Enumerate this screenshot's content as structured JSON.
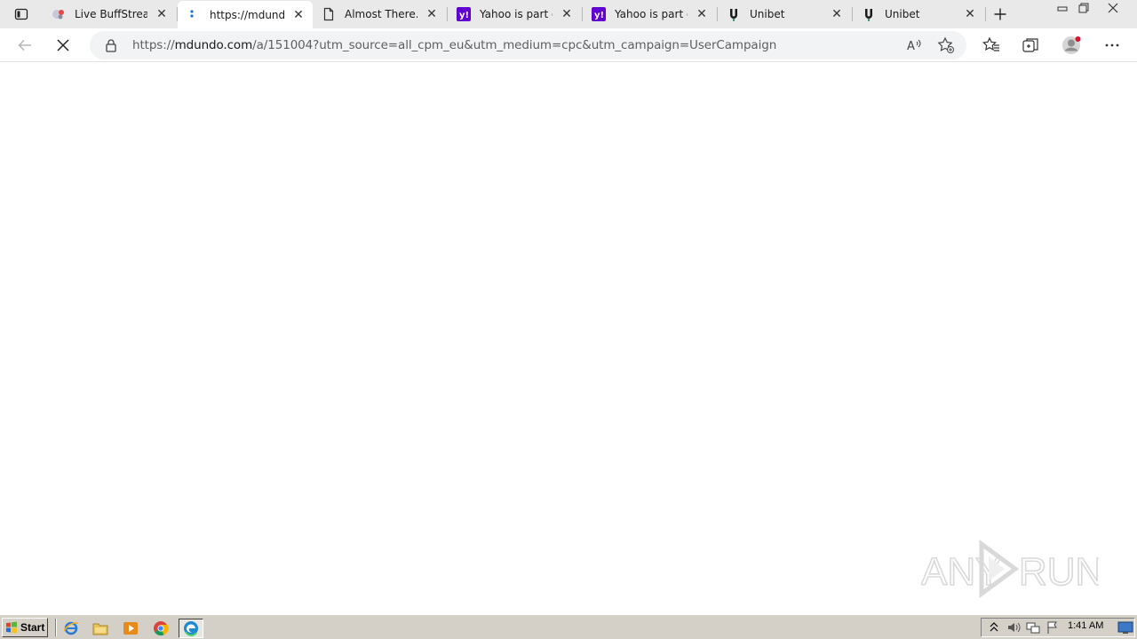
{
  "browser": {
    "tabs": [
      {
        "title": "Live BuffStreams",
        "favicon": "buffstreams-favicon",
        "active": false
      },
      {
        "title": "https://mdundo",
        "favicon": "mdundo-favicon",
        "active": true
      },
      {
        "title": "Almost There...",
        "favicon": "page-icon",
        "active": false
      },
      {
        "title": "Yahoo is part of t",
        "favicon": "yahoo-favicon",
        "active": false
      },
      {
        "title": "Yahoo is part of t",
        "favicon": "yahoo-favicon",
        "active": false
      },
      {
        "title": "Unibet",
        "favicon": "unibet-favicon",
        "active": false
      },
      {
        "title": "Unibet",
        "favicon": "unibet-favicon",
        "active": false
      }
    ],
    "address": {
      "url_prefix": "https://",
      "url_host": "mdundo.com",
      "url_rest": "/a/151004?utm_source=all_cpm_eu&utm_medium=cpc&utm_campaign=UserCampaign"
    },
    "loading": true
  },
  "watermark": {
    "text_left": "ANY",
    "text_right": "RUN"
  },
  "taskbar": {
    "start_label": "Start",
    "quick_launch": [
      "ie-icon",
      "folder-icon",
      "media-player-icon",
      "chrome-icon",
      "edge-icon"
    ],
    "clock": "1:41 AM"
  },
  "colors": {
    "yahoo": "#6001d2",
    "unibet": "#147b45",
    "taskbar": "#d4d0c8",
    "tabstrip": "#e9e9e9"
  }
}
